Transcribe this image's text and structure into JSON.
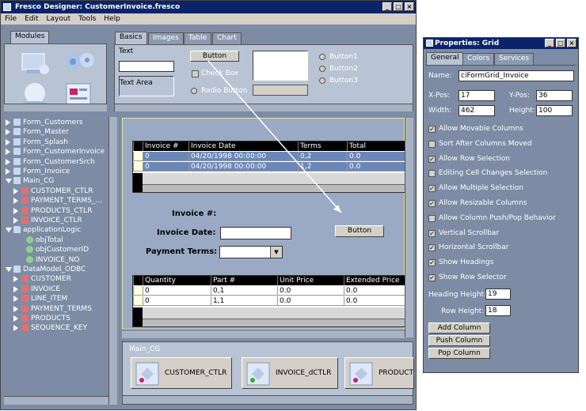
{
  "main_window": {
    "title": "Fresco Designer: CustomerInvoice.fresco",
    "menu": [
      "File",
      "Edit",
      "Layout",
      "Tools",
      "Help"
    ]
  },
  "left_tabs": [
    "Modules"
  ],
  "palette_tabs": [
    "Basics",
    "Images",
    "Table",
    "Chart"
  ],
  "palette": {
    "text_label": "Text",
    "button_label": "Button",
    "textarea_label": "Text Area",
    "checkbox_label": "Check Box",
    "radio_label": "Radio Button",
    "radios": [
      "Button1",
      "Button2",
      "Button3"
    ]
  },
  "tree": [
    {
      "label": "Form_Customers",
      "level": 0,
      "expanded": false
    },
    {
      "label": "Form_Master",
      "level": 0,
      "expanded": false
    },
    {
      "label": "Form_Splash",
      "level": 0,
      "expanded": false
    },
    {
      "label": "Form_CustomerInvoice",
      "level": 0,
      "expanded": false
    },
    {
      "label": "Form_CustomerSrch",
      "level": 0,
      "expanded": false
    },
    {
      "label": "Form_Invoice",
      "level": 0,
      "expanded": false
    },
    {
      "label": "Main_CG",
      "level": 0,
      "expanded": true
    },
    {
      "label": "CUSTOMER_CTLR",
      "level": 1,
      "expanded": false
    },
    {
      "label": "PAYMENT_TERMS_...",
      "level": 1,
      "expanded": false
    },
    {
      "label": "PRODUCTS_CTLR",
      "level": 1,
      "expanded": false
    },
    {
      "label": "INVOICE_CTLR",
      "level": 1,
      "expanded": false
    },
    {
      "label": "applicationLogic",
      "level": 0,
      "expanded": true
    },
    {
      "label": "objTotal",
      "level": 2,
      "expanded": false
    },
    {
      "label": "objCustomerID",
      "level": 2,
      "expanded": false
    },
    {
      "label": "INVOICE_NO",
      "level": 2,
      "expanded": false
    },
    {
      "label": "DataModel_ODBC",
      "level": 0,
      "expanded": true
    },
    {
      "label": "CUSTOMER",
      "level": 1,
      "expanded": false
    },
    {
      "label": "INVOICE",
      "level": 1,
      "expanded": false
    },
    {
      "label": "LINE_ITEM",
      "level": 1,
      "expanded": false
    },
    {
      "label": "PAYMENT_TERMS",
      "level": 1,
      "expanded": false
    },
    {
      "label": "PRODUCTS",
      "level": 1,
      "expanded": false
    },
    {
      "label": "SEQUENCE_KEY",
      "level": 1,
      "expanded": false
    }
  ],
  "form": {
    "grid1": {
      "headers": [
        "Invoice #",
        "Invoice Date",
        "Terms",
        "Total"
      ],
      "rows": [
        [
          "0",
          "04/20/1998 00:00:00",
          "0,2",
          "0.0"
        ],
        [
          "0",
          "04/20/1998 00:00:00",
          "1,2",
          "0.0"
        ]
      ]
    },
    "invoice_no_label": "Invoice #:",
    "invoice_date_label": "Invoice Date:",
    "payment_terms_label": "Payment Terms:",
    "button_label": "Button",
    "grid2": {
      "headers": [
        "Quantity",
        "Part #",
        "Unit Price",
        "Extended Price"
      ],
      "rows": [
        [
          "0",
          "0,1",
          "0.0",
          "0.0"
        ],
        [
          "0",
          "1,1",
          "0.0",
          "0.0"
        ]
      ]
    }
  },
  "bottom_panel": {
    "title": "Main_CG",
    "items": [
      "CUSTOMER_CTLR",
      "INVOICE_dCTLR",
      "PRODUCT"
    ]
  },
  "properties": {
    "title": "Properties: Grid",
    "tabs": [
      "General",
      "Colors",
      "Services"
    ],
    "name_label": "Name:",
    "name_value": "ciFormGrid_Invoice",
    "xpos_label": "X-Pos:",
    "xpos_value": "17",
    "ypos_label": "Y-Pos:",
    "ypos_value": "36",
    "width_label": "Width:",
    "width_value": "462",
    "height_label": "Height:",
    "height_value": "100",
    "checks": [
      {
        "label": "Allow Movable Columns",
        "checked": true
      },
      {
        "label": "Sort After Columns Moved",
        "checked": false
      },
      {
        "label": "Allow Row Selection",
        "checked": true
      },
      {
        "label": "Editing Cell Changes Selection",
        "checked": false
      },
      {
        "label": "Allow Multiple Selection",
        "checked": true
      },
      {
        "label": "Allow Resizable Columns",
        "checked": true
      },
      {
        "label": "Allow Column Push/Pop Behavior",
        "checked": false
      },
      {
        "label": "Vertical Scrollbar",
        "checked": true
      },
      {
        "label": "Horizontal Scrollbar",
        "checked": true
      },
      {
        "label": "Show Headings",
        "checked": true
      },
      {
        "label": "Show Row Selector",
        "checked": true
      }
    ],
    "heading_height_label": "Heading Height:",
    "heading_height_value": "19",
    "row_height_label": "Row Height:",
    "row_height_value": "18",
    "buttons": [
      "Add Column",
      "Push Column",
      "Pop Column"
    ]
  },
  "colors": {
    "titlebar": "#0a246a",
    "panel": "#7d8ca4",
    "canvas": "#9aaac4",
    "selected_row": "#6b87b8"
  }
}
